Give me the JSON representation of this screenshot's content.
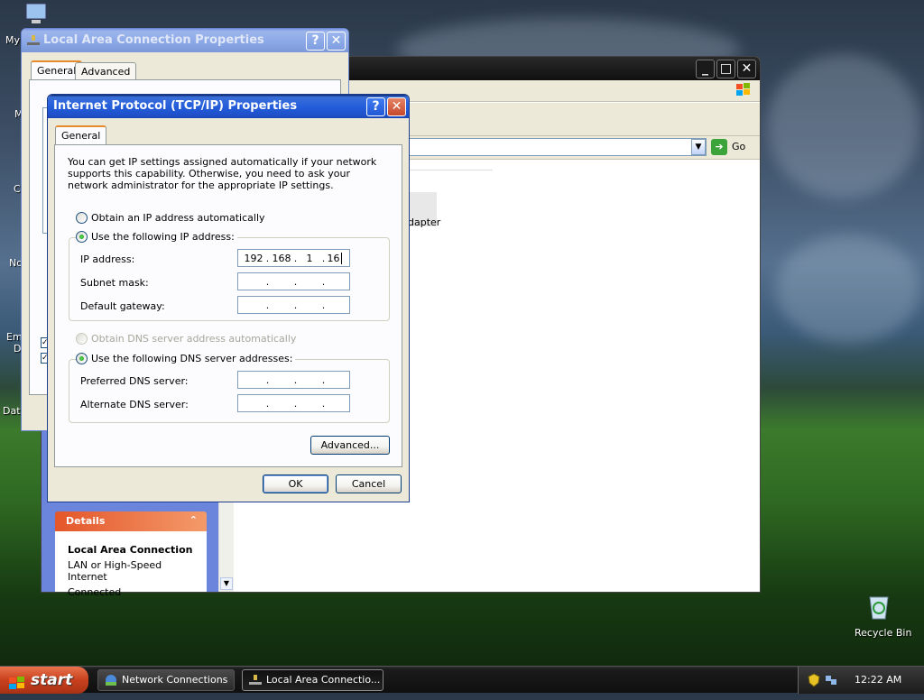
{
  "desktop": {
    "icons_left": [
      "My",
      "M",
      "C",
      "No",
      "Em",
      "D",
      "Dat"
    ],
    "recycle_bin": "Recycle Bin"
  },
  "explorer": {
    "go_label": "Go",
    "adapter_fragment": "dapter",
    "details_title": "Details",
    "details_name": "Local Area Connection",
    "details_type": "LAN or High-Speed Internet",
    "details_status": "Connected"
  },
  "lac_window": {
    "title": "Local Area Connection Properties",
    "tabs": [
      "General",
      "Advanced"
    ]
  },
  "tcpip": {
    "title": "Internet Protocol (TCP/IP) Properties",
    "tab": "General",
    "intro": "You can get IP settings assigned automatically if your network supports this capability. Otherwise, you need to ask your network administrator for the appropriate IP settings.",
    "radio_auto_ip": "Obtain an IP address automatically",
    "radio_manual_ip": "Use the following IP address:",
    "ip_label": "IP address:",
    "ip_value": [
      "192",
      "168",
      "1",
      "16"
    ],
    "subnet_label": "Subnet mask:",
    "gateway_label": "Default gateway:",
    "radio_auto_dns": "Obtain DNS server address automatically",
    "radio_manual_dns": "Use the following DNS server addresses:",
    "pref_dns_label": "Preferred DNS server:",
    "alt_dns_label": "Alternate DNS server:",
    "advanced_button": "Advanced...",
    "ok_button": "OK",
    "cancel_button": "Cancel",
    "help_glyph": "?",
    "close_glyph": "✕"
  },
  "taskbar": {
    "start_label": "start",
    "tasks": [
      "Network Connections",
      "Local Area Connectio..."
    ],
    "clock": "12:22 AM"
  },
  "colors": {
    "xp_blue": "#245edb",
    "details_orange": "#e3562a"
  }
}
